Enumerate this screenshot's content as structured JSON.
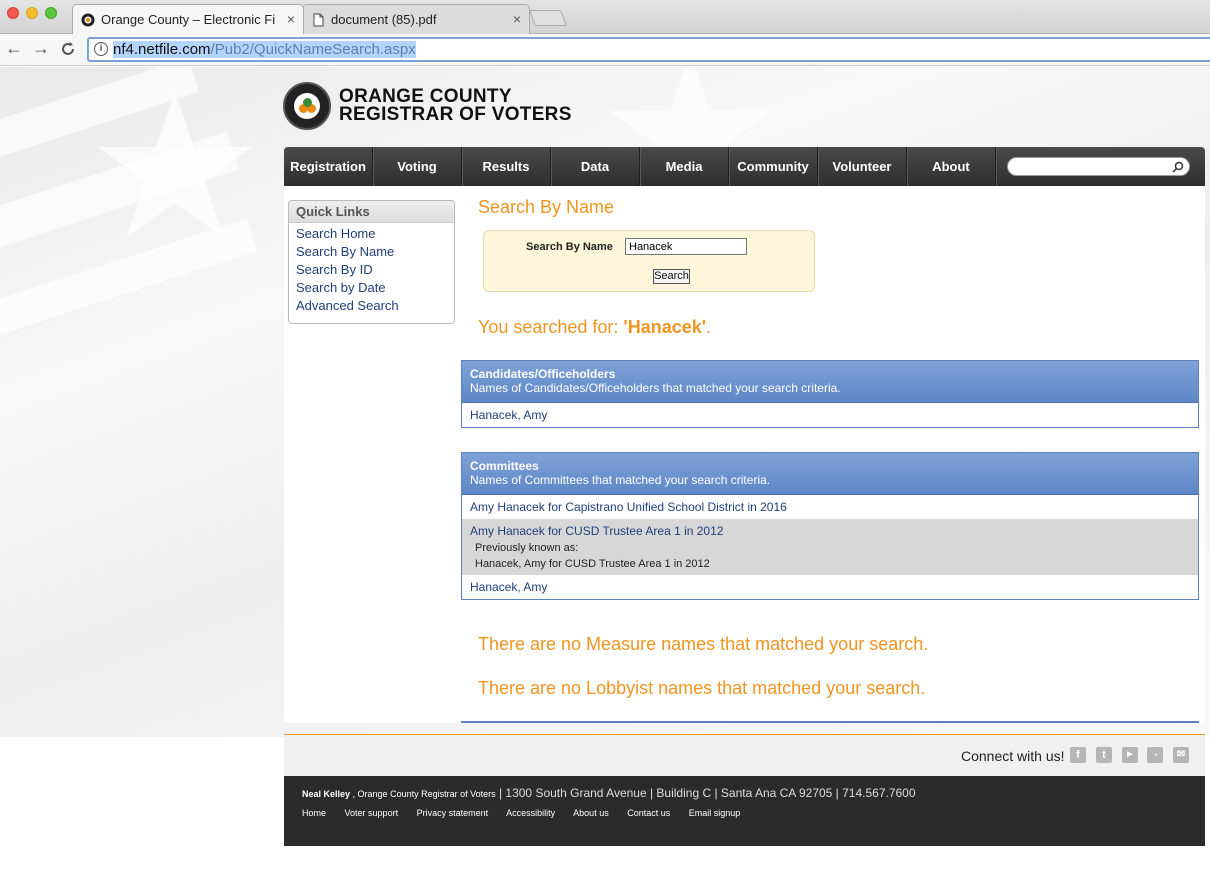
{
  "browser": {
    "tabs": [
      {
        "title": "Orange County – Electronic Fi",
        "close": "×"
      },
      {
        "title": "document (85).pdf",
        "close": "×"
      }
    ],
    "url_host": "nf4.netfile.com",
    "url_path": "/Pub2/QuickNameSearch.aspx",
    "back": "←",
    "forward": "→",
    "reload": "C"
  },
  "site": {
    "title_line1": "ORANGE COUNTY",
    "title_line2": "REGISTRAR OF VOTERS",
    "nav": [
      "Registration",
      "Voting",
      "Results",
      "Data",
      "Media",
      "Community",
      "Volunteer",
      "About"
    ],
    "search_placeholder": ""
  },
  "quick_links": {
    "title": "Quick Links",
    "items": [
      "Search Home",
      "Search By Name",
      "Search By ID",
      "Search by Date",
      "Advanced Search"
    ]
  },
  "search": {
    "heading": "Search By Name",
    "label": "Search By Name",
    "value": "Hanacek",
    "button": "Search",
    "searched_prefix": "You searched for: ",
    "searched_term": "'Hanacek'",
    "searched_suffix": "."
  },
  "candidates": {
    "title": "Candidates/Officeholders",
    "subtitle": "Names of Candidates/Officeholders that matched your search criteria.",
    "rows": [
      "Hanacek, Amy"
    ]
  },
  "committees": {
    "title": "Committees",
    "subtitle": "Names of Committees that matched your search criteria.",
    "row1": "Amy Hanacek for Capistrano Unified School District in 2016",
    "row2": "Amy Hanacek for CUSD Trustee Area 1 in 2012",
    "row2_prev_label": "Previously known as:",
    "row2_prev_name": "Hanacek, Amy for CUSD Trustee Area 1 in 2012",
    "row3": "Hanacek, Amy"
  },
  "no_measure": "There are no Measure names that matched your search.",
  "no_lobbyist": "There are no Lobbyist names that matched your search.",
  "footer": {
    "connect": "Connect with us!",
    "name": "Neal Kelley",
    "sep1": " , ",
    "role": "Orange County Registrar of Voters",
    "address": " | 1300 South Grand Avenue | Building C | Santa Ana CA 92705 | 714.567.7600",
    "links": [
      "Home",
      "Voter support",
      "Privacy statement",
      "Accessibility",
      "About us",
      "Contact us",
      "Email signup"
    ],
    "social_icons": [
      "facebook-icon",
      "twitter-icon",
      "youtube-icon",
      "rss-icon",
      "email-icon"
    ]
  },
  "colors": {
    "accent": "#f1941f",
    "nav_bg": "#3a3a3a",
    "panel_head": "#6f94cf",
    "link": "#1f3f7a"
  }
}
